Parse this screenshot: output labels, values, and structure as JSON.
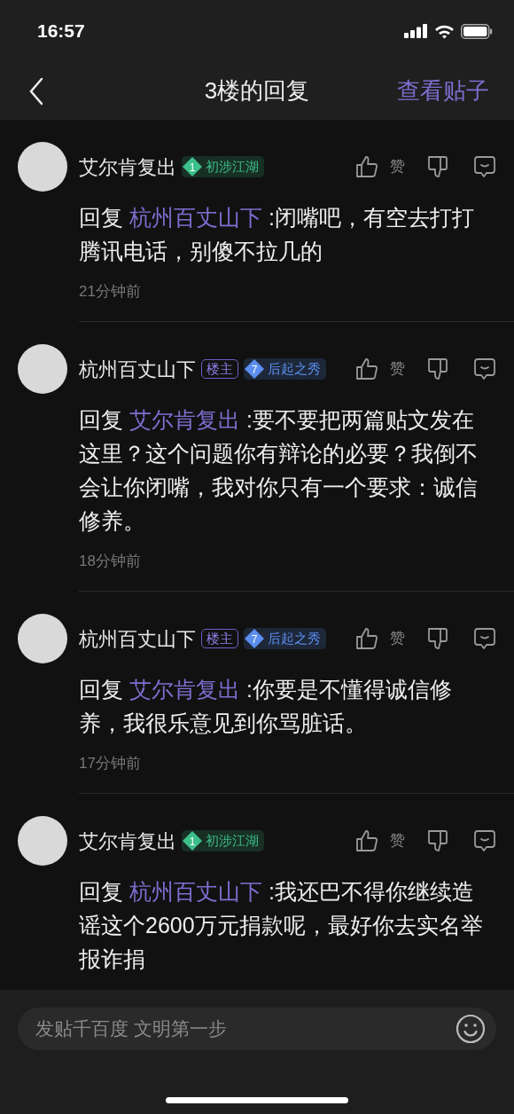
{
  "status_bar": {
    "time": "16:57"
  },
  "nav": {
    "title": "3楼的回复",
    "action": "查看贴子"
  },
  "comments": [
    {
      "user": "艾尔肯复出",
      "level": {
        "number": "1",
        "title": "初涉江湖",
        "color": "#3dbf8a"
      },
      "like_label": "赞",
      "reply_prefix": "回复",
      "reply_to": "杭州百丈山下",
      "text": ":闭嘴吧，有空去打打腾讯电话，别傻不拉几的",
      "time": "21分钟前"
    },
    {
      "user": "杭州百丈山下",
      "op_badge": "楼主",
      "level": {
        "number": "7",
        "title": "后起之秀",
        "color": "#5b8ef0"
      },
      "like_label": "赞",
      "reply_prefix": "回复",
      "reply_to": "艾尔肯复出",
      "text": ":要不要把两篇贴文发在这里？这个问题你有辩论的必要？我倒不会让你闭嘴，我对你只有一个要求：诚信修养。",
      "time": "18分钟前"
    },
    {
      "user": "杭州百丈山下",
      "op_badge": "楼主",
      "level": {
        "number": "7",
        "title": "后起之秀",
        "color": "#5b8ef0"
      },
      "like_label": "赞",
      "reply_prefix": "回复",
      "reply_to": "艾尔肯复出",
      "text": ":你要是不懂得诚信修养，我很乐意见到你骂脏话。",
      "time": "17分钟前"
    },
    {
      "user": "艾尔肯复出",
      "level": {
        "number": "1",
        "title": "初涉江湖",
        "color": "#3dbf8a"
      },
      "like_label": "赞",
      "reply_prefix": "回复",
      "reply_to": "杭州百丈山下",
      "text": ":我还巴不得你继续造谣这个2600万元捐款呢，最好你去实名举报诈捐"
    }
  ],
  "composer": {
    "placeholder": "发贴千百度 文明第一步"
  }
}
